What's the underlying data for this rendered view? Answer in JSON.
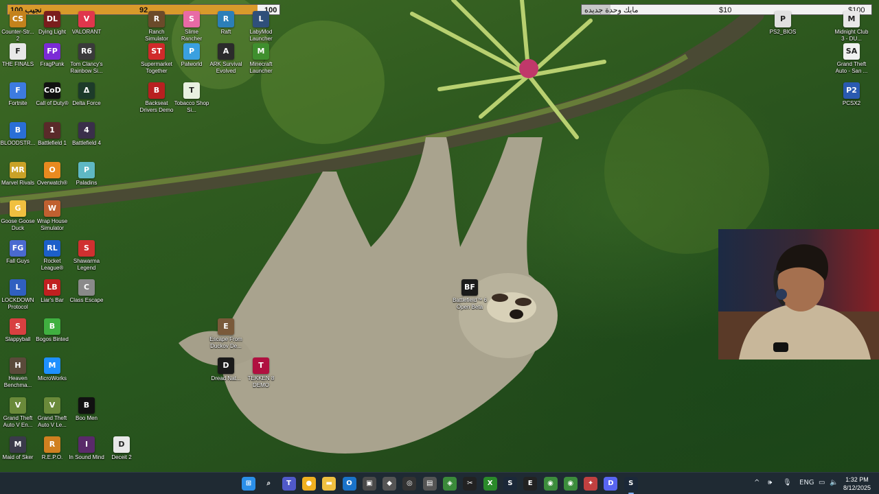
{
  "goals": {
    "left": {
      "label": "نجيب 100",
      "current": "92",
      "target": "100",
      "fraction": 0.92
    },
    "right": {
      "label": "مايك وحدة جديده",
      "current": "$10",
      "target": "$100",
      "fraction": 0.1
    }
  },
  "desktop_icons": [
    {
      "label": "Counter-Str... 2",
      "color": "#c4821c",
      "glyph": "CS"
    },
    {
      "label": "Dying Light",
      "color": "#7a1d1d",
      "glyph": "DL"
    },
    {
      "label": "VALORANT",
      "color": "#e0364c",
      "glyph": "V"
    },
    {
      "label": "Ranch Simulator",
      "color": "#6b4a2a",
      "glyph": "R"
    },
    {
      "label": "Slime Rancher",
      "color": "#e86aa5",
      "glyph": "S"
    },
    {
      "label": "Raft",
      "color": "#2c7fb8",
      "glyph": "R"
    },
    {
      "label": "LabyMod Launcher",
      "color": "#2f4f7a",
      "glyph": "L"
    },
    {
      "label": "THE FINALS",
      "color": "#e8e8e8",
      "glyph": "F"
    },
    {
      "label": "FragPunk",
      "color": "#7b2bd6",
      "glyph": "FP"
    },
    {
      "label": "Tom Clancy's Rainbow Si...",
      "color": "#3a3a3a",
      "glyph": "R6"
    },
    {
      "label": "Supermarket Together",
      "color": "#d02a2a",
      "glyph": "ST"
    },
    {
      "label": "Palworld",
      "color": "#3aa0e0",
      "glyph": "P"
    },
    {
      "label": "ARK Survival Evolved",
      "color": "#2b2b2b",
      "glyph": "A"
    },
    {
      "label": "Minecraft Launcher",
      "color": "#3f8f2e",
      "glyph": "M"
    },
    {
      "label": "Fortnite",
      "color": "#3d7be0",
      "glyph": "F"
    },
    {
      "label": "Call of Duty®",
      "color": "#111111",
      "glyph": "CoD"
    },
    {
      "label": "Delta Force",
      "color": "#1d3b2a",
      "glyph": "Δ"
    },
    {
      "label": "Backseat Drivers Demo",
      "color": "#b82020",
      "glyph": "B"
    },
    {
      "label": "Tobacco Shop Si...",
      "color": "#e8f0e0",
      "glyph": "T"
    },
    {
      "label": "BLOODSTR...",
      "color": "#2a6fd6",
      "glyph": "B"
    },
    {
      "label": "Battlefield 1",
      "color": "#5a2a2a",
      "glyph": "1"
    },
    {
      "label": "Battlefield 4",
      "color": "#3a2f4a",
      "glyph": "4"
    },
    {
      "label": "Marvel Rivals",
      "color": "#c9a227",
      "glyph": "MR"
    },
    {
      "label": "Overwatch®",
      "color": "#e98a1f",
      "glyph": "O"
    },
    {
      "label": "Paladins",
      "color": "#5fb8c4",
      "glyph": "P"
    },
    {
      "label": "Goose Goose Duck",
      "color": "#f0c040",
      "glyph": "G"
    },
    {
      "label": "Wrap House Simulator",
      "color": "#c06030",
      "glyph": "W"
    },
    {
      "label": "Fall Guys",
      "color": "#4a6ad0",
      "glyph": "FG"
    },
    {
      "label": "Rocket League®",
      "color": "#1c5fc9",
      "glyph": "RL"
    },
    {
      "label": "Shawarma Legend",
      "color": "#d03030",
      "glyph": "S"
    },
    {
      "label": "LOCKDOWN Protocol",
      "color": "#3060c0",
      "glyph": "L"
    },
    {
      "label": "Liar's Bar",
      "color": "#c02020",
      "glyph": "LB"
    },
    {
      "label": "Class Escape",
      "color": "#8a8a8a",
      "glyph": "C"
    },
    {
      "label": "Slappyball",
      "color": "#d84040",
      "glyph": "S"
    },
    {
      "label": "Bogos Binted",
      "color": "#40b040",
      "glyph": "B"
    },
    {
      "label": "Heaven Benchma...",
      "color": "#5a4a3a",
      "glyph": "H"
    },
    {
      "label": "MicroWorks",
      "color": "#1e90ff",
      "glyph": "M"
    },
    {
      "label": "Grand Theft Auto V En...",
      "color": "#6a8a3a",
      "glyph": "V"
    },
    {
      "label": "Grand Theft Auto V Le...",
      "color": "#6a8a3a",
      "glyph": "V"
    },
    {
      "label": "Boo Men",
      "color": "#111111",
      "glyph": "B"
    },
    {
      "label": "Maid of Sker",
      "color": "#3a3a4a",
      "glyph": "M"
    },
    {
      "label": "R.E.P.O.",
      "color": "#d08020",
      "glyph": "R"
    },
    {
      "label": "In Sound Mind",
      "color": "#5a2a6a",
      "glyph": "I"
    },
    {
      "label": "Deceit 2",
      "color": "#e8e8e8",
      "glyph": "D"
    },
    {
      "label": "Escape From Duckov De...",
      "color": "#7a5a3a",
      "glyph": "E"
    },
    {
      "label": "Dread Nat...",
      "color": "#1a1a1a",
      "glyph": "D"
    },
    {
      "label": "TEKKEN 8 DEMO",
      "color": "#b01040",
      "glyph": "T"
    },
    {
      "label": "Battlefield™ 6 Open Beta",
      "color": "#1a1a1a",
      "glyph": "BF"
    },
    {
      "label": "PS2_BIOS",
      "color": "#e0e0e0",
      "glyph": "P"
    },
    {
      "label": "Midnight Club 3 - DU...",
      "color": "#e8e8e8",
      "glyph": "M"
    },
    {
      "label": "Grand Theft Auto - San ...",
      "color": "#f0f0f0",
      "glyph": "SA"
    },
    {
      "label": "PCSX2",
      "color": "#2a5ab0",
      "glyph": "P2"
    }
  ],
  "taskbar": {
    "apps": [
      {
        "name": "start",
        "color": "#2b8fe8",
        "glyph": "⊞"
      },
      {
        "name": "search",
        "color": "transparent",
        "glyph": "⌕"
      },
      {
        "name": "teams",
        "color": "#5059c9",
        "glyph": "T"
      },
      {
        "name": "yellow-app",
        "color": "#f0b020",
        "glyph": "●"
      },
      {
        "name": "file-explorer",
        "color": "#f0c040",
        "glyph": "▬"
      },
      {
        "name": "outlook",
        "color": "#1a73c9",
        "glyph": "O"
      },
      {
        "name": "store",
        "color": "#4a4a4a",
        "glyph": "▣"
      },
      {
        "name": "app-box",
        "color": "#555",
        "glyph": "◆"
      },
      {
        "name": "app-circle",
        "color": "#333",
        "glyph": "◎"
      },
      {
        "name": "app-note",
        "color": "#555",
        "glyph": "▤"
      },
      {
        "name": "app-bundle",
        "color": "#3a8a3a",
        "glyph": "◈"
      },
      {
        "name": "capcut",
        "color": "#222",
        "glyph": "✂"
      },
      {
        "name": "xbox",
        "color": "#2a8a2a",
        "glyph": "X"
      },
      {
        "name": "steam",
        "color": "#1b2838",
        "glyph": "S"
      },
      {
        "name": "epic",
        "color": "#222",
        "glyph": "E"
      },
      {
        "name": "chrome-1",
        "color": "#3c8d3c",
        "glyph": "◉"
      },
      {
        "name": "chrome-2",
        "color": "#3c8d3c",
        "glyph": "◉"
      },
      {
        "name": "app-red",
        "color": "#c04040",
        "glyph": "✦"
      },
      {
        "name": "discord",
        "color": "#5865f2",
        "glyph": "D"
      },
      {
        "name": "steam-active",
        "color": "#1b2838",
        "glyph": "S"
      }
    ],
    "tray": {
      "chevron": "^",
      "language": "ENG",
      "time": "1:32 PM",
      "date": "8/12/2025"
    }
  }
}
